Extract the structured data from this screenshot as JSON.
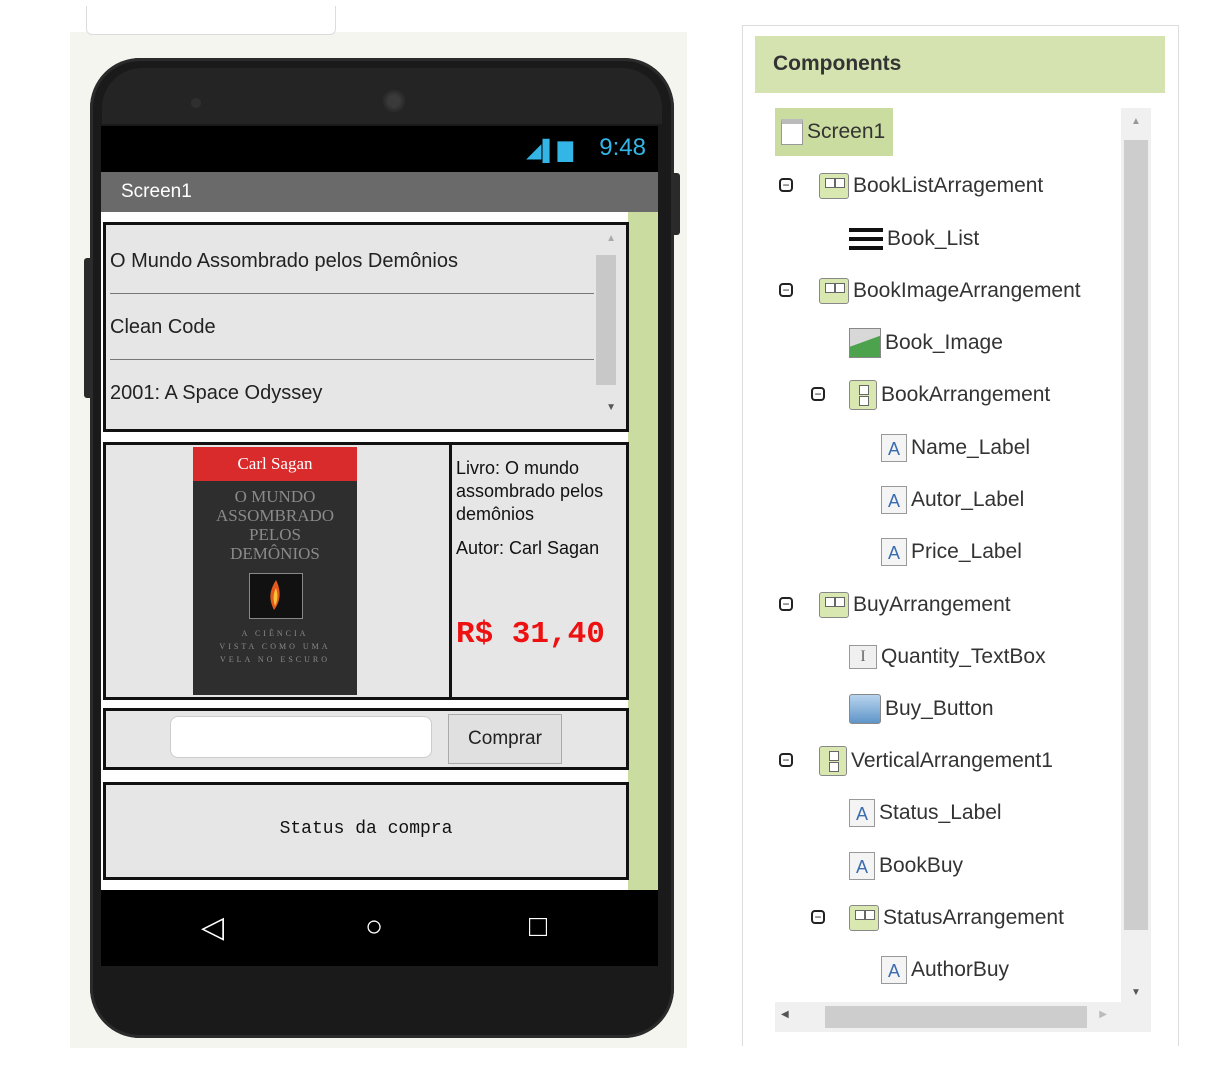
{
  "phone": {
    "status_time": "9:48",
    "screen_title": "Screen1",
    "book_list": [
      "O Mundo Assombrado pelos Demônios",
      "Clean Code",
      "2001: A Space Odyssey"
    ],
    "cover": {
      "author": "Carl Sagan",
      "title_lines": [
        "O MUNDO",
        "ASSOMBRADO",
        "PELOS",
        "DEMÔNIOS"
      ],
      "subtitle_lines": [
        "A CIÊNCIA",
        "VISTA COMO UMA",
        "VELA NO ESCURO"
      ]
    },
    "info": {
      "livro": "Livro: O mundo assombrado pelos demônios",
      "autor": "Autor: Carl Sagan",
      "price": "R$ 31,40"
    },
    "buy": {
      "quantity_value": "",
      "button_label": "Comprar"
    },
    "status_text": "Status da compra"
  },
  "components": {
    "title": "Components",
    "nodes": [
      {
        "label": "Screen1",
        "icon": "screen-icon"
      },
      {
        "label": "BookListArragement",
        "icon": "horizontal-arrangement-icon"
      },
      {
        "label": "Book_List",
        "icon": "listview-icon"
      },
      {
        "label": "BookImageArrangement",
        "icon": "horizontal-arrangement-icon"
      },
      {
        "label": "Book_Image",
        "icon": "image-icon"
      },
      {
        "label": "BookArrangement",
        "icon": "vertical-arrangement-icon"
      },
      {
        "label": "Name_Label",
        "icon": "label-icon"
      },
      {
        "label": "Autor_Label",
        "icon": "label-icon"
      },
      {
        "label": "Price_Label",
        "icon": "label-icon"
      },
      {
        "label": "BuyArrangement",
        "icon": "horizontal-arrangement-icon"
      },
      {
        "label": "Quantity_TextBox",
        "icon": "textbox-icon"
      },
      {
        "label": "Buy_Button",
        "icon": "button-icon"
      },
      {
        "label": "VerticalArrangement1",
        "icon": "vertical-arrangement-icon"
      },
      {
        "label": "Status_Label",
        "icon": "label-icon"
      },
      {
        "label": "BookBuy",
        "icon": "label-icon"
      },
      {
        "label": "StatusArrangement",
        "icon": "horizontal-arrangement-icon"
      },
      {
        "label": "AuthorBuy",
        "icon": "label-icon"
      }
    ]
  },
  "colors": {
    "panel_header": "#d4e3b0",
    "selected": "#cbdca0",
    "price": "#ee1111",
    "status_icons": "#33b5e5"
  }
}
